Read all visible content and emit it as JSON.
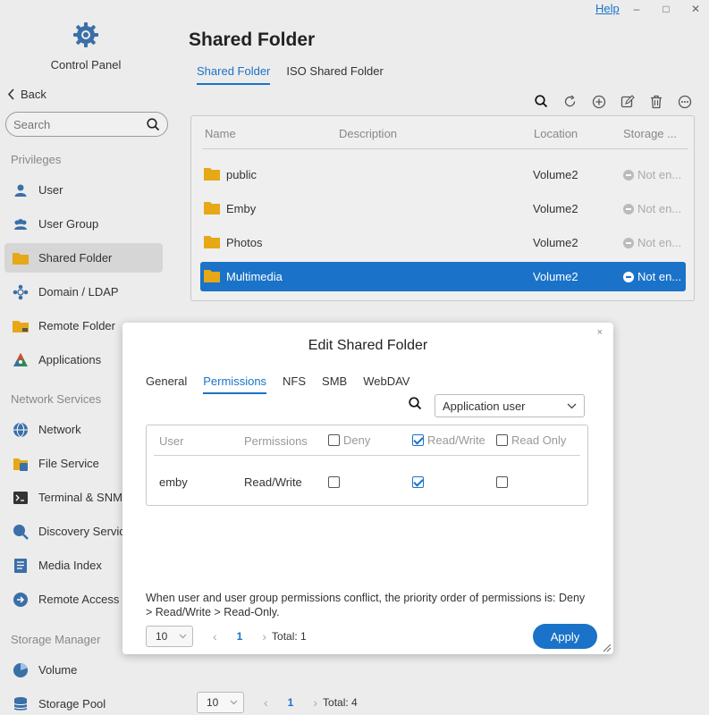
{
  "window": {
    "help": "Help",
    "minimize": "–",
    "maximize": "□",
    "close": "✕"
  },
  "sidebar": {
    "app_label": "Control Panel",
    "back": "Back",
    "search_placeholder": "Search",
    "sections": [
      {
        "title": "Privileges",
        "items": [
          {
            "label": "User",
            "icon": "user-icon"
          },
          {
            "label": "User Group",
            "icon": "user-group-icon"
          },
          {
            "label": "Shared Folder",
            "icon": "folder-icon",
            "active": true
          },
          {
            "label": "Domain / LDAP",
            "icon": "domain-icon"
          },
          {
            "label": "Remote Folder",
            "icon": "remote-folder-icon"
          },
          {
            "label": "Applications",
            "icon": "applications-icon"
          }
        ]
      },
      {
        "title": "Network Services",
        "items": [
          {
            "label": "Network",
            "icon": "network-icon"
          },
          {
            "label": "File Service",
            "icon": "file-service-icon"
          },
          {
            "label": "Terminal & SNMP",
            "icon": "terminal-icon"
          },
          {
            "label": "Discovery Service",
            "icon": "discovery-icon"
          },
          {
            "label": "Media Index",
            "icon": "media-index-icon"
          },
          {
            "label": "Remote Access",
            "icon": "remote-access-icon"
          }
        ]
      },
      {
        "title": "Storage Manager",
        "items": [
          {
            "label": "Volume",
            "icon": "volume-icon"
          },
          {
            "label": "Storage Pool",
            "icon": "storage-pool-icon"
          }
        ]
      }
    ]
  },
  "main": {
    "title": "Shared Folder",
    "tabs": [
      "Shared Folder",
      "ISO Shared Folder"
    ],
    "columns": [
      "Name",
      "Description",
      "Location",
      "Storage ..."
    ],
    "rows": [
      {
        "name": "public",
        "description": "",
        "location": "Volume2",
        "storage": "Not en..."
      },
      {
        "name": "Emby",
        "description": "",
        "location": "Volume2",
        "storage": "Not en..."
      },
      {
        "name": "Photos",
        "description": "",
        "location": "Volume2",
        "storage": "Not en..."
      },
      {
        "name": "Multimedia",
        "description": "",
        "location": "Volume2",
        "storage": "Not en...",
        "selected": true
      }
    ],
    "pager": {
      "page_size": "10",
      "page": "1",
      "total": "Total: 4"
    }
  },
  "modal": {
    "title": "Edit Shared Folder",
    "close": "×",
    "tabs": [
      "General",
      "Permissions",
      "NFS",
      "SMB",
      "WebDAV"
    ],
    "active_tab": "Permissions",
    "user_type": "Application user",
    "columns": {
      "user": "User",
      "permissions": "Permissions",
      "deny": "Deny",
      "rw": "Read/Write",
      "ro": "Read Only"
    },
    "rows": [
      {
        "user": "emby",
        "permissions": "Read/Write",
        "deny": false,
        "rw": true,
        "ro": false
      }
    ],
    "note": "When user and user group permissions conflict, the priority order of permissions is: Deny > Read/Write > Read-Only.",
    "pager": {
      "page_size": "10",
      "page": "1",
      "total": "Total: 1"
    },
    "apply": "Apply"
  },
  "colors": {
    "accent": "#1a73c8",
    "folder": "#e6a817"
  }
}
